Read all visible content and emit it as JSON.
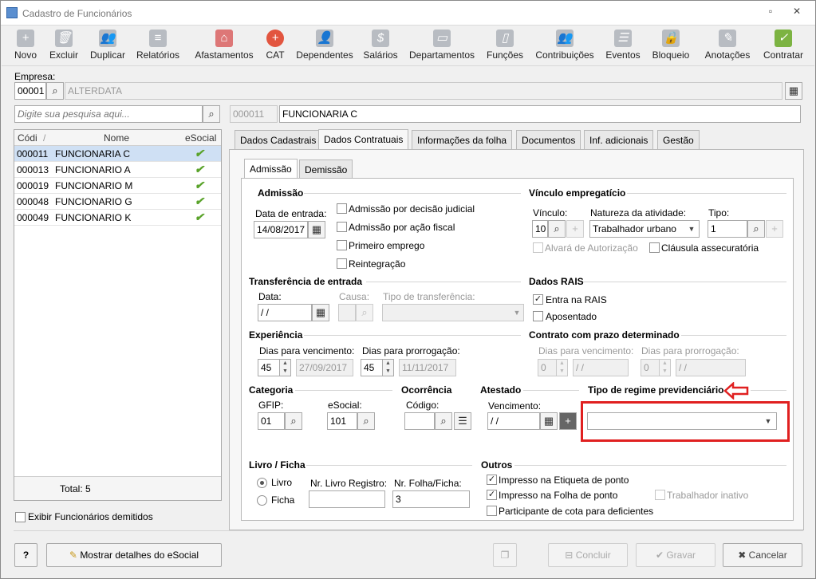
{
  "window": {
    "title": "Cadastro de Funcionários"
  },
  "toolbar": [
    "Novo",
    "Excluir",
    "Duplicar",
    "Relatórios",
    "Afastamentos",
    "CAT",
    "Dependentes",
    "Salários",
    "Departamentos",
    "Funções",
    "Contribuições",
    "Eventos",
    "Bloqueio",
    "Anotações",
    "Contratar"
  ],
  "empresa": {
    "label": "Empresa:",
    "code": "00001",
    "name": "ALTERDATA"
  },
  "search": {
    "placeholder": "Digite sua pesquisa aqui..."
  },
  "employee": {
    "code": "000011",
    "name": "FUNCIONARIA C"
  },
  "grid": {
    "headers": [
      "Códi",
      "Nome",
      "eSocial"
    ],
    "rows": [
      {
        "code": "000011",
        "name": "FUNCIONARIA C"
      },
      {
        "code": "000013",
        "name": "FUNCIONARIO A"
      },
      {
        "code": "000019",
        "name": "FUNCIONARIO M"
      },
      {
        "code": "000048",
        "name": "FUNCIONARIO G"
      },
      {
        "code": "000049",
        "name": "FUNCIONARIO K"
      }
    ],
    "total": "Total: 5"
  },
  "show_dismissed": "Exibir Funcionários demitidos",
  "tabs": [
    "Dados Cadastrais",
    "Dados Contratuais",
    "Informações da folha",
    "Documentos",
    "Inf. adicionais",
    "Gestão"
  ],
  "subtabs": [
    "Admissão",
    "Demissão"
  ],
  "admissao": {
    "title": "Admissão",
    "data_label": "Data de entrada:",
    "data": "14/08/2017",
    "options": [
      "Admissão por decisão judicial",
      "Admissão por ação fiscal",
      "Primeiro emprego",
      "Reintegração"
    ]
  },
  "vinculo": {
    "title": "Vínculo empregatício",
    "vinculo_label": "Vínculo:",
    "vinculo": "10",
    "natureza_label": "Natureza da atividade:",
    "natureza": "Trabalhador urbano",
    "tipo_label": "Tipo:",
    "tipo": "1",
    "alvara": "Alvará de Autorização",
    "clausula": "Cláusula assecuratória"
  },
  "transferencia": {
    "title": "Transferência de entrada",
    "data_label": "Data:",
    "data": " / /",
    "causa_label": "Causa:",
    "tipo_label": "Tipo de transferência:"
  },
  "rais": {
    "title": "Dados RAIS",
    "entra": "Entra na RAIS",
    "aposentado": "Aposentado"
  },
  "experiencia": {
    "title": "Experiência",
    "venc_label": "Dias para vencimento:",
    "venc": "45",
    "venc_date": "27/09/2017",
    "prorr_label": "Dias para prorrogação:",
    "prorr": "45",
    "prorr_date": "11/11/2017"
  },
  "contrato": {
    "title": "Contrato com prazo determinado",
    "venc_label": "Dias para vencimento:",
    "venc": "0",
    "venc_date": " / /",
    "prorr_label": "Dias para prorrogação:",
    "prorr": "0",
    "prorr_date": " / /"
  },
  "categoria": {
    "title": "Categoria",
    "gfip_label": "GFIP:",
    "gfip": "01",
    "esocial_label": "eSocial:",
    "esocial": "101"
  },
  "ocorrencia": {
    "title": "Ocorrência",
    "codigo_label": "Código:"
  },
  "atestado": {
    "title": "Atestado",
    "venc_label": "Vencimento:",
    "venc": " / /"
  },
  "regime": {
    "title": "Tipo de regime previdenciário"
  },
  "livro": {
    "title": "Livro / Ficha",
    "opt1": "Livro",
    "opt2": "Ficha",
    "nr_livro_label": "Nr. Livro Registro:",
    "nr_folha_label": "Nr. Folha/Ficha:",
    "nr_folha": "3"
  },
  "outros": {
    "title": "Outros",
    "etiqueta": "Impresso na Etiqueta de ponto",
    "folha": "Impresso na Folha de ponto",
    "inativo": "Trabalhador inativo",
    "cota": "Participante de cota para deficientes"
  },
  "footer": {
    "help": "?",
    "esocial_btn": "Mostrar detalhes do eSocial",
    "concluir": "Concluir",
    "gravar": "Gravar",
    "cancelar": "Cancelar"
  }
}
